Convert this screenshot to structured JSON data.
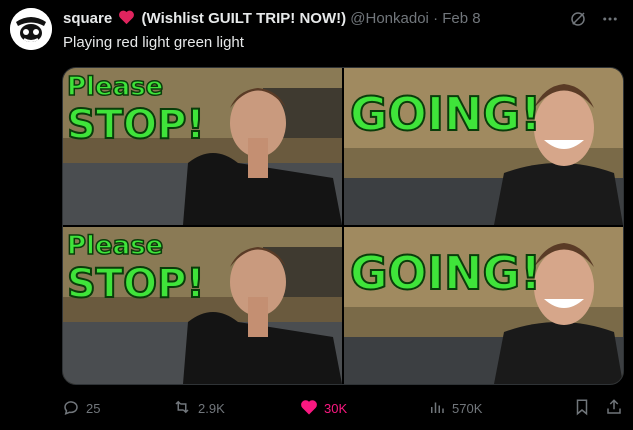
{
  "tweet": {
    "display_name": "square",
    "name_suffix": "(Wishlist GUILT TRIP! NOW!)",
    "handle": "@Honkadoi",
    "separator": "·",
    "date": "Feb 8",
    "text": "Playing red light green light"
  },
  "media": {
    "panels": [
      {
        "line1": "Please",
        "line2": "STOP!",
        "kind": "stop"
      },
      {
        "line1": "",
        "line2": "GOING!",
        "kind": "go"
      },
      {
        "line1": "Please",
        "line2": "STOP!",
        "kind": "stop"
      },
      {
        "line1": "",
        "line2": "GOING!",
        "kind": "go"
      }
    ]
  },
  "actions": {
    "replies": "25",
    "reposts": "2.9K",
    "likes": "30K",
    "views": "570K"
  },
  "colors": {
    "accent_like": "#f91880",
    "caption_green": "#3fe43a",
    "muted": "#71767b"
  },
  "icons": [
    "grok-icon",
    "more-icon",
    "reply-icon",
    "repost-icon",
    "heart-icon",
    "views-icon",
    "bookmark-icon",
    "share-icon"
  ]
}
